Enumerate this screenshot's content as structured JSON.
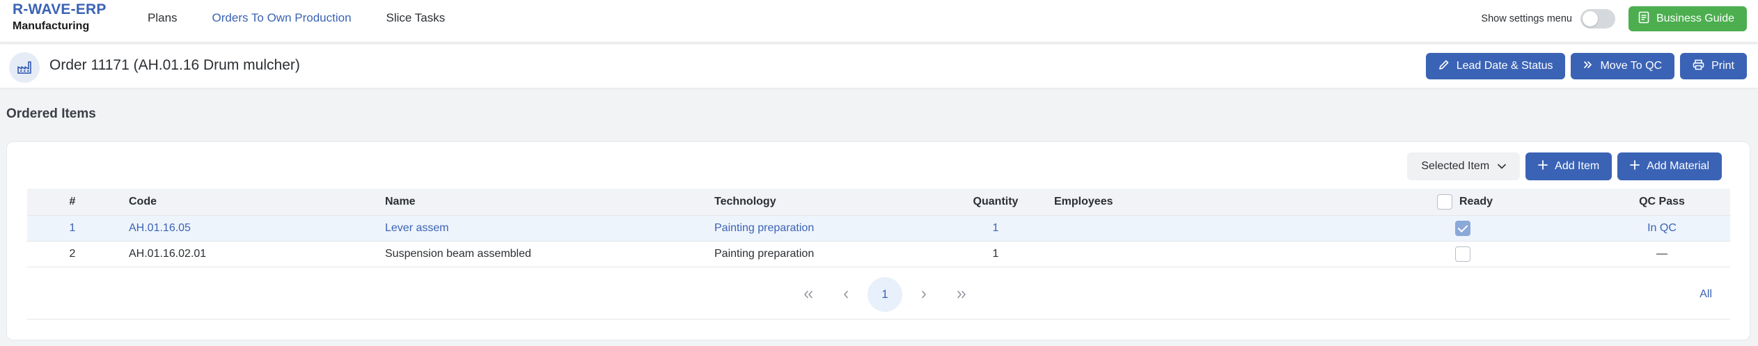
{
  "app": {
    "name": "R-WAVE-ERP",
    "module": "Manufacturing"
  },
  "nav": {
    "items": [
      "Plans",
      "Orders To Own Production",
      "Slice Tasks"
    ],
    "active_index": 1
  },
  "settings": {
    "label": "Show settings menu",
    "enabled": false
  },
  "business_guide": {
    "label": "Business Guide",
    "color": "#4cae4f"
  },
  "order": {
    "title": "Order 11171 (AH.01.16 Drum mulcher)",
    "actions": {
      "lead_date": "Lead Date & Status",
      "move_qc": "Move To QC",
      "print": "Print"
    }
  },
  "section": {
    "title": "Ordered Items"
  },
  "toolbar": {
    "selected_item": "Selected Item",
    "add_item": "Add Item",
    "add_material": "Add Material"
  },
  "table": {
    "headers": {
      "num": "#",
      "code": "Code",
      "name": "Name",
      "technology": "Technology",
      "quantity": "Quantity",
      "employees": "Employees",
      "ready": "Ready",
      "qc_pass": "QC Pass"
    },
    "rows": [
      {
        "num": "1",
        "code": "AH.01.16.05",
        "name": "Lever assem",
        "technology": "Painting preparation",
        "quantity": "1",
        "employees": "",
        "ready": true,
        "qc_pass": "In QC",
        "selected": true
      },
      {
        "num": "2",
        "code": "AH.01.16.02.01",
        "name": "Suspension beam assembled",
        "technology": "Painting preparation",
        "quantity": "1",
        "employees": "",
        "ready": false,
        "qc_pass": "—",
        "selected": false
      }
    ]
  },
  "pagination": {
    "current": "1",
    "all_label": "All"
  },
  "colors": {
    "accent": "#3b63b5",
    "success": "#4cae4f",
    "selected_row": "#eef4fc"
  }
}
